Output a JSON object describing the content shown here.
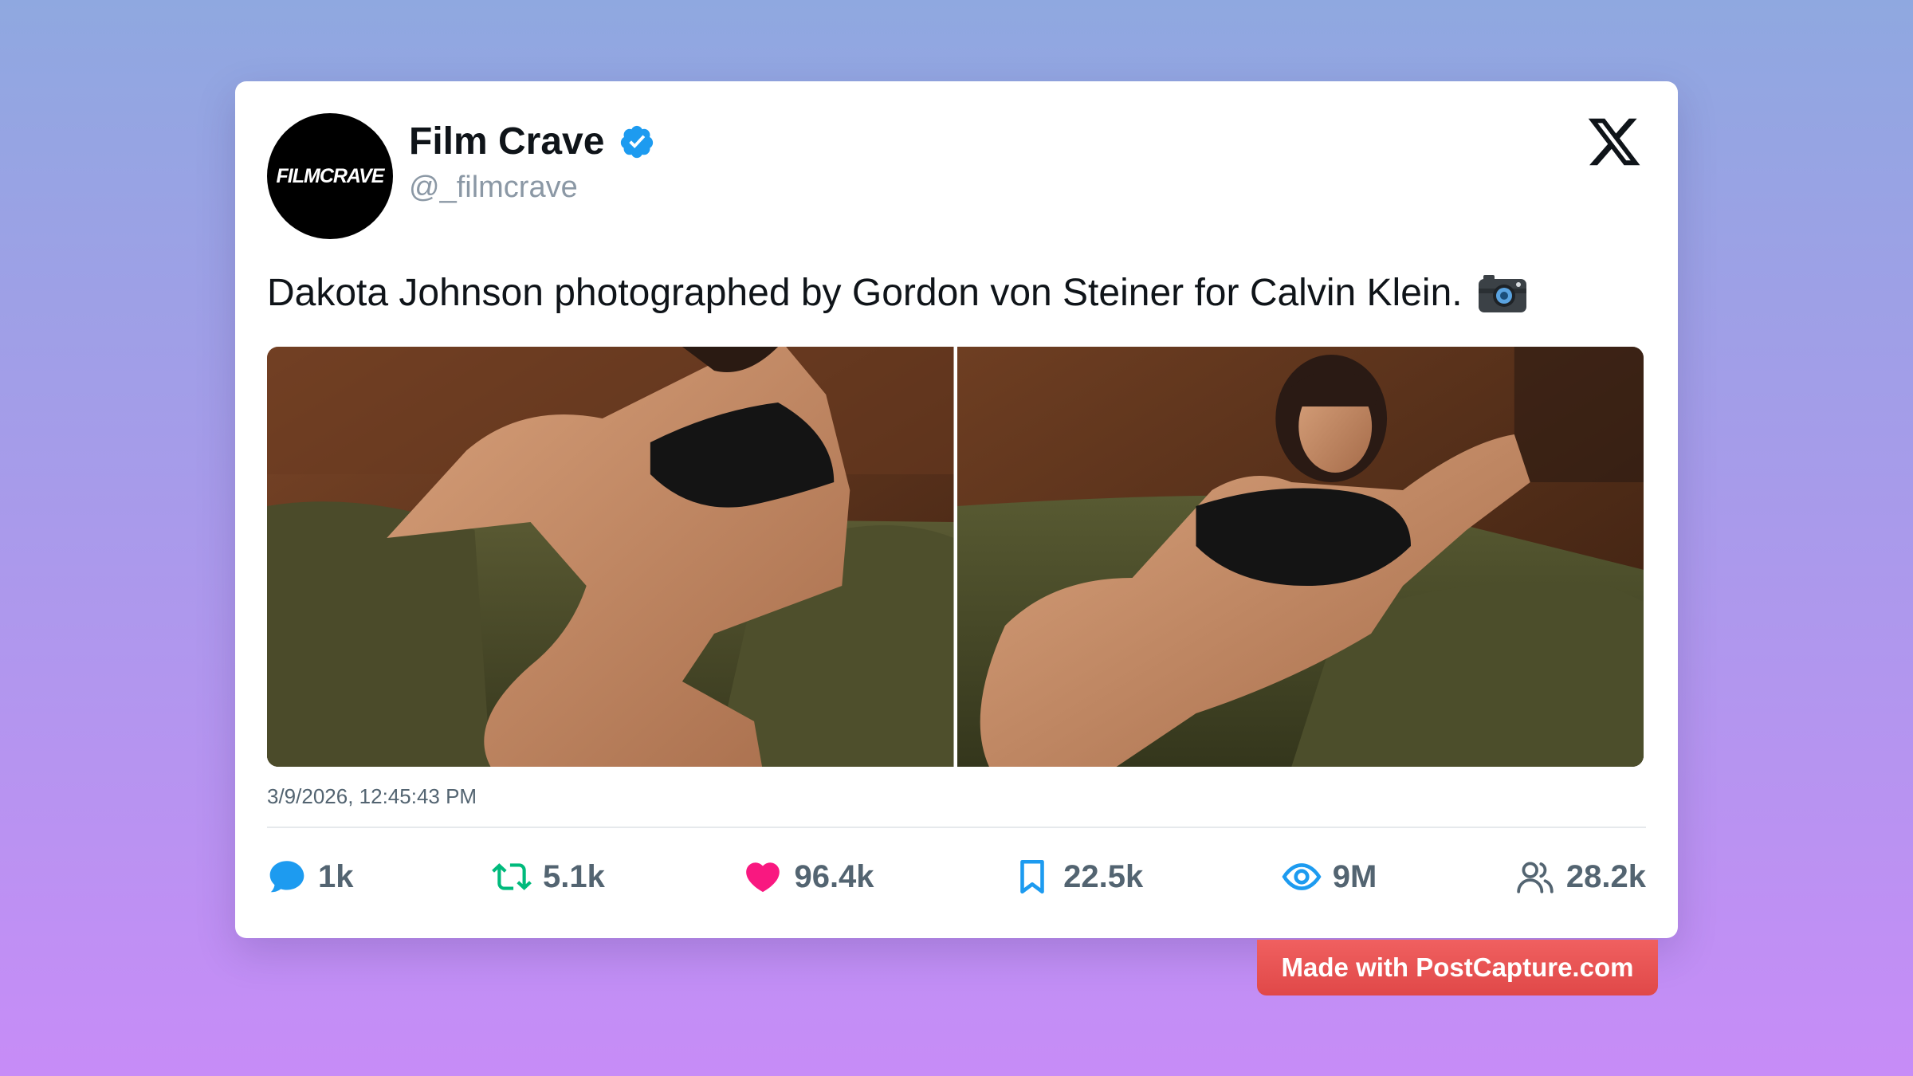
{
  "author": {
    "display_name": "Film Crave",
    "handle": "@_filmcrave",
    "avatar_text": "FILMCRAVE",
    "verified": true
  },
  "tweet": {
    "text": "Dakota Johnson photographed by Gordon von Steiner for Calvin Klein.",
    "emoji_icon": "camera-icon",
    "timestamp": "3/9/2026, 12:45:43 PM"
  },
  "stats": {
    "replies": "1k",
    "retweets": "5.1k",
    "likes": "96.4k",
    "bookmarks": "22.5k",
    "views": "9M",
    "followers": "28.2k"
  },
  "watermark": {
    "label": "Made with PostCapture.com"
  },
  "colors": {
    "verified": "#1d9bf0",
    "reply": "#1d9bf0",
    "retweet": "#00ba7c",
    "like": "#f91880",
    "bookmark": "#1d9bf0",
    "views": "#1d9bf0",
    "watermark": "#e55353"
  }
}
